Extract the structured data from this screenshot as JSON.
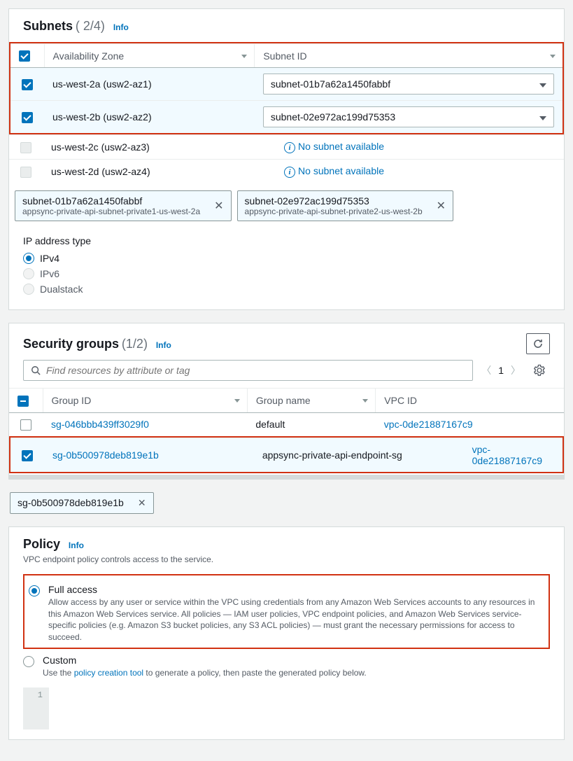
{
  "subnets": {
    "title": "Subnets",
    "count": "( 2/4)",
    "info": "Info",
    "headers": {
      "az": "Availability Zone",
      "subnet_id": "Subnet ID"
    },
    "rows": [
      {
        "checked": true,
        "az": "us-west-2a (usw2-az1)",
        "subnet": "subnet-01b7a62a1450fabbf",
        "has_subnet": true
      },
      {
        "checked": true,
        "az": "us-west-2b (usw2-az2)",
        "subnet": "subnet-02e972ac199d75353",
        "has_subnet": true
      },
      {
        "checked": false,
        "az": "us-west-2c (usw2-az3)",
        "subnet": "No subnet available",
        "has_subnet": false
      },
      {
        "checked": false,
        "az": "us-west-2d (usw2-az4)",
        "subnet": "No subnet available",
        "has_subnet": false
      }
    ],
    "tags": [
      {
        "id": "subnet-01b7a62a1450fabbf",
        "desc": "appsync-private-api-subnet-private1-us-west-2a"
      },
      {
        "id": "subnet-02e972ac199d75353",
        "desc": "appsync-private-api-subnet-private2-us-west-2b"
      }
    ],
    "ip_label": "IP address type",
    "ip_options": {
      "ipv4": "IPv4",
      "ipv6": "IPv6",
      "dual": "Dualstack"
    }
  },
  "sg": {
    "title": "Security groups",
    "count": "(1/2)",
    "info": "Info",
    "search_placeholder": "Find resources by attribute or tag",
    "page": "1",
    "headers": {
      "gid": "Group ID",
      "gname": "Group name",
      "vpc": "VPC ID"
    },
    "rows": [
      {
        "checked": false,
        "gid": "sg-046bbb439ff3029f0",
        "gname": "default",
        "vpc": "vpc-0de21887167c9"
      },
      {
        "checked": true,
        "gid": "sg-0b500978deb819e1b",
        "gname": "appsync-private-api-endpoint-sg",
        "vpc": "vpc-0de21887167c9"
      }
    ],
    "selected_tag": "sg-0b500978deb819e1b"
  },
  "policy": {
    "title": "Policy",
    "info": "Info",
    "subtitle": "VPC endpoint policy controls access to the service.",
    "full": {
      "label": "Full access",
      "desc": "Allow access by any user or service within the VPC using credentials from any Amazon Web Services accounts to any resources in this Amazon Web Services service. All policies — IAM user policies, VPC endpoint policies, and Amazon Web Services service-specific policies (e.g. Amazon S3 bucket policies, any S3 ACL policies) — must grant the necessary permissions for access to succeed."
    },
    "custom": {
      "label": "Custom",
      "desc_pre": "Use the ",
      "desc_link": "policy creation tool",
      "desc_post": " to generate a policy, then paste the generated policy below."
    },
    "line1": "1"
  }
}
